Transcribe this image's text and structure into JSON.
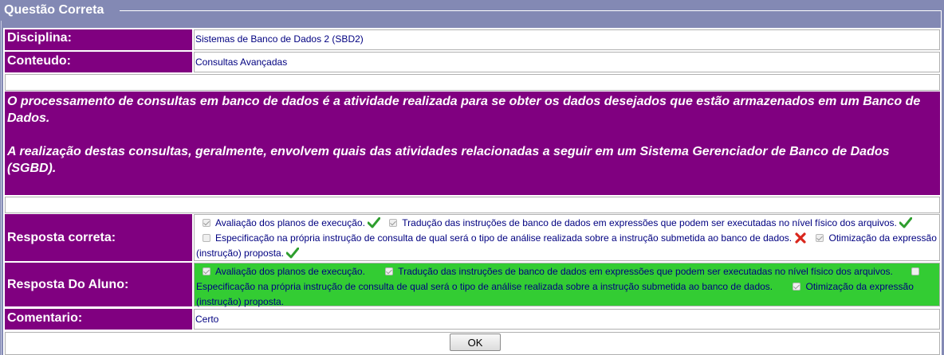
{
  "fieldset": {
    "legend": "Questão Correta"
  },
  "disciplina": {
    "label": "Disciplina:",
    "value": "Sistemas de Banco de Dados 2 (SBD2)"
  },
  "conteudo": {
    "label": "Conteudo:",
    "value": "Consultas Avançadas"
  },
  "question": {
    "paragraph1": "O processamento de consultas em banco de dados é a atividade realizada para se obter os dados desejados que estão armazenados em um Banco de Dados.",
    "paragraph2": "A realização destas consultas, geralmente, envolvem quais das atividades relacionadas a seguir em um Sistema Gerenciador de Banco de Dados (SGBD)."
  },
  "resposta_correta": {
    "label": "Resposta correta:",
    "options": [
      {
        "text": "Avaliação dos planos de execução.",
        "checked": true,
        "mark": "check-icon"
      },
      {
        "text": "Tradução das instruções de banco de dados em expressões que podem ser executadas no nível físico dos arquivos.",
        "checked": true,
        "mark": "check-icon"
      },
      {
        "text": "Especificação na própria instrução de consulta de qual será o tipo de análise realizada sobre a instrução submetida ao banco de dados.",
        "checked": false,
        "mark": "cross-icon"
      },
      {
        "text": "Otimização da expressão (instrução) proposta.",
        "checked": true,
        "mark": "check-icon"
      }
    ]
  },
  "resposta_aluno": {
    "label": "Resposta Do Aluno:",
    "options": [
      {
        "text": "Avaliação dos planos de execução.",
        "checked": true
      },
      {
        "text": "Tradução das instruções de banco de dados em expressões que podem ser executadas no nível físico dos arquivos.",
        "checked": true
      },
      {
        "text": "Especificação na própria instrução de consulta de qual será o tipo de análise realizada sobre a instrução submetida ao banco de dados.",
        "checked": false
      },
      {
        "text": "Otimização da expressão (instrução) proposta.",
        "checked": true
      }
    ]
  },
  "comentario": {
    "label": "Comentario:",
    "value": "Certo"
  },
  "ok_button": {
    "label": "OK"
  },
  "colors": {
    "label_bg": "#800080",
    "page_bg": "#8389b4",
    "correct_bg": "#33cc33",
    "value_text": "#000080",
    "check": "#2e9e2e",
    "cross": "#d9261c"
  }
}
